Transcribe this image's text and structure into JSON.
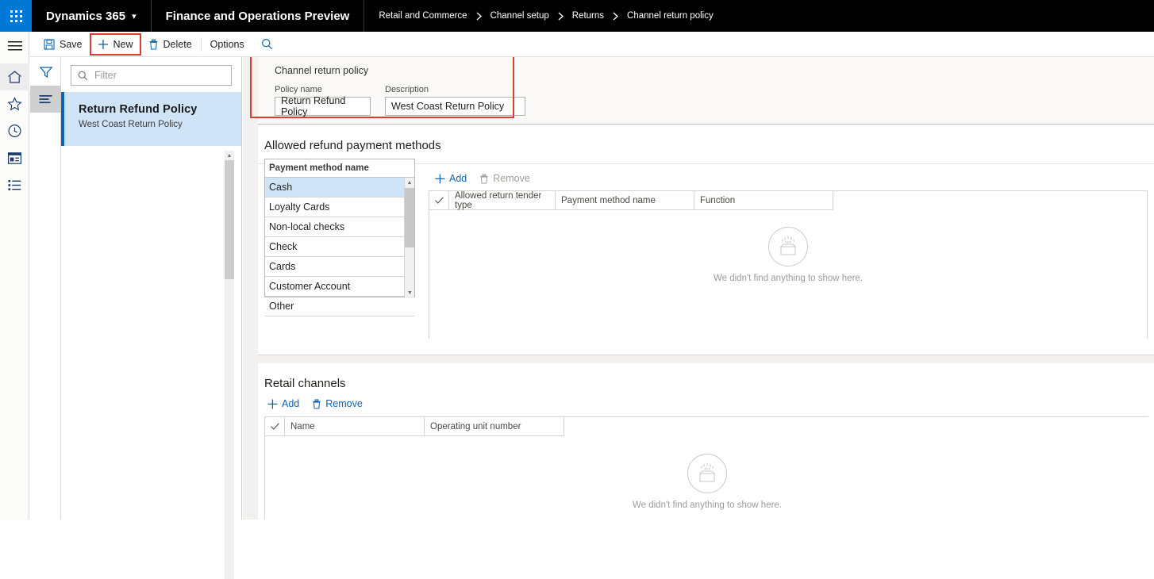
{
  "topbar": {
    "waffle_icon": "app-launcher-icon",
    "brand": "Dynamics 365",
    "brand_chevron": "chevron-down-icon",
    "product": "Finance and Operations Preview",
    "breadcrumb": [
      "Retail and Commerce",
      "Channel setup",
      "Returns",
      "Channel return policy"
    ],
    "breadcrumb_separator": "chevron-right-icon"
  },
  "rail": {
    "items": [
      {
        "name": "hamburger-menu",
        "icon": "hamburger-icon"
      },
      {
        "name": "home",
        "icon": "home-icon"
      },
      {
        "name": "favorites",
        "icon": "star-icon"
      },
      {
        "name": "recent",
        "icon": "clock-icon"
      },
      {
        "name": "workspaces",
        "icon": "workspace-icon"
      },
      {
        "name": "modules",
        "icon": "list-icon"
      }
    ]
  },
  "rail_secondary": {
    "items": [
      {
        "name": "filter-pane",
        "icon": "funnel-icon",
        "active": false
      },
      {
        "name": "list-pane",
        "icon": "lines-icon",
        "active": true
      }
    ]
  },
  "commandbar": {
    "save_label": "Save",
    "new_label": "New",
    "delete_label": "Delete",
    "options_label": "Options",
    "search_icon": "search-icon",
    "highlight_color": "#e03b2f"
  },
  "listpanel": {
    "filter_placeholder": "Filter",
    "filter_value": "",
    "filter_icon": "search-icon",
    "items": [
      {
        "title": "Return Refund Policy",
        "subtitle": "West Coast Return Policy",
        "selected": true
      }
    ]
  },
  "header_card": {
    "title": "Channel return policy",
    "fields": [
      {
        "label": "Policy name",
        "value": "Return Refund Policy"
      },
      {
        "label": "Description",
        "value": "West Coast Return Policy"
      }
    ]
  },
  "refund_section": {
    "title": "Allowed refund payment methods",
    "payment_list": {
      "header": "Payment method name",
      "rows": [
        "Cash",
        "Loyalty Cards",
        "Non-local checks",
        "Check",
        "Cards",
        "Customer Account",
        "Other"
      ],
      "selected_index": 0
    },
    "toolbar": {
      "add_label": "Add",
      "add_icon": "plus-icon",
      "add_enabled": true,
      "remove_label": "Remove",
      "remove_icon": "trash-icon",
      "remove_enabled": false
    },
    "grid": {
      "columns": [
        "Allowed return tender type",
        "Payment method name",
        "Function"
      ],
      "select_all_icon": "checkmark-icon",
      "rows": [],
      "empty_message": "We didn't find anything to show here.",
      "empty_icon": "empty-box-icon"
    }
  },
  "channels_section": {
    "title": "Retail channels",
    "toolbar": {
      "add_label": "Add",
      "add_icon": "plus-icon",
      "add_enabled": true,
      "remove_label": "Remove",
      "remove_icon": "trash-icon",
      "remove_enabled": true
    },
    "grid": {
      "columns": [
        "Name",
        "Operating unit number"
      ],
      "select_all_icon": "checkmark-icon",
      "rows": [],
      "empty_message": "We didn't find anything to show here.",
      "empty_icon": "empty-box-icon"
    }
  },
  "theme": {
    "accent": "#0078d4",
    "link": "#0b64b5",
    "selection": "#cfe4f7",
    "annotation": "#e03b2f",
    "canvas_bg": "#f2f1f0"
  }
}
